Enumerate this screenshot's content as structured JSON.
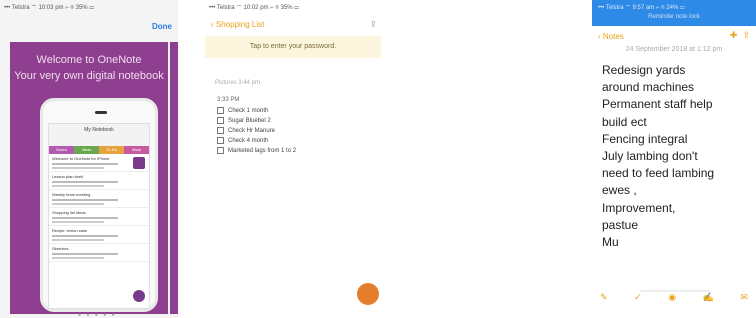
{
  "panel1": {
    "status": "••• Telstra ⌔   10:03 pm   ⌐ ⌾ 35% ▭",
    "done": "Done",
    "headline1": "Welcome to OneNote",
    "headline2": "Your very own digital notebook",
    "notebook_title": "My Notebook",
    "tabs": [
      "Notes",
      "Ideas",
      "To-Do",
      "Work"
    ],
    "rows": [
      {
        "title": "Welcome to OneNote for iPhone"
      },
      {
        "title": "Lesson plan draft"
      },
      {
        "title": "Weekly team meeting"
      },
      {
        "title": "Shopping list ideas"
      },
      {
        "title": "Recipe: lemon cake"
      },
      {
        "title": "Sketches"
      }
    ],
    "dots": "● ● ● ● ●"
  },
  "panel2": {
    "status": "••• Telstra ⌔   10:02 pm   ⌐ ⌾ 35% ▭",
    "back": "Shopping List",
    "banner": "Tap to enter your password.",
    "meta": "Pictures      3:44 pm",
    "section": "3:33 PM",
    "items": [
      "Check 1 month",
      "Sugar Bluebel 2",
      "Check Hr Manure",
      "Check 4 month",
      "Marketed lags from 1 to 2"
    ]
  },
  "panel3": {
    "status": "••• Telstra ⌔   9:57 am   ⌐ ⌾ 24% ▭",
    "sub": "Reminder note lock",
    "back": "Notes",
    "date": "24 September 2018 at 1:12 pm",
    "lines": [
      "Redesign yards",
      "around machines",
      "Permanent staff help",
      "build ect",
      "Fencing integral",
      "July lambing don't",
      "need to feed lambing",
      "ewes ,",
      "Improvement,",
      "pastue",
      "Mu"
    ],
    "toolbar": [
      "✎",
      "✓",
      "◉",
      "✍",
      "✉"
    ]
  }
}
